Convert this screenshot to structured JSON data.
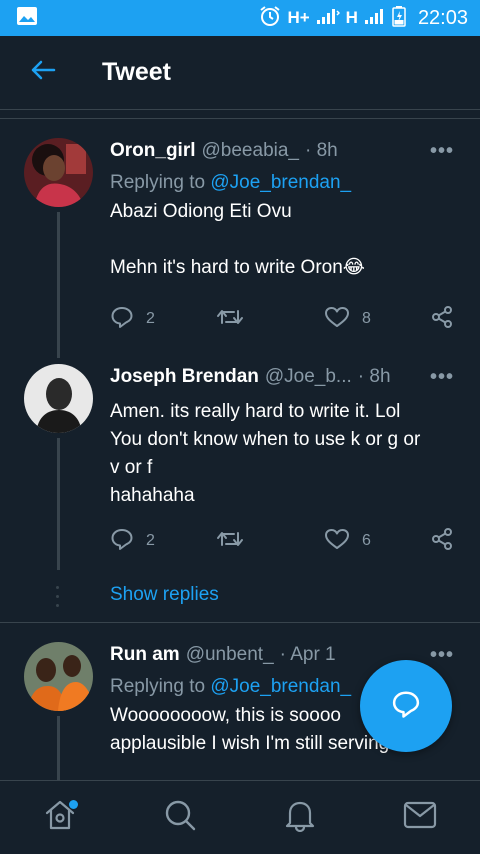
{
  "status_bar": {
    "network_1": "H+",
    "network_2": "H",
    "time": "22:03"
  },
  "app_bar": {
    "back_icon": "arrow-left-icon",
    "title": "Tweet"
  },
  "tweets": [
    {
      "name": "Oron_girl",
      "handle": "@beeabia_",
      "time": "· 8h",
      "replying_label": "Replying to",
      "replying_to": "@Joe_brendan_",
      "text": "Abazi Odiong Eti Ovu\n\nMehn it's hard to write Oron😂",
      "replies": "2",
      "likes": "8"
    },
    {
      "name": "Joseph Brendan",
      "handle": "@Joe_b...",
      "time": "· 8h",
      "text": "Amen. its really hard to write it. Lol\nYou don't know when to use k or g or\nv or f\nhahahaha",
      "replies": "2",
      "likes": "6"
    },
    {
      "name": "Run am",
      "handle": "@unbent_",
      "time": "· Apr 1",
      "replying_label": "Replying to",
      "replying_to": "@Joe_brendan_",
      "text": "Woooooooow, this is soooo\napplausible I wish I'm still serving"
    }
  ],
  "show_replies": "Show replies",
  "more_label": "•••",
  "colors": {
    "background": "#15202b",
    "accent": "#1da1f2",
    "secondary_text": "#8899a6",
    "border": "#38444d"
  },
  "bottom_nav": [
    "home-icon",
    "search-icon",
    "notifications-icon",
    "messages-icon"
  ]
}
